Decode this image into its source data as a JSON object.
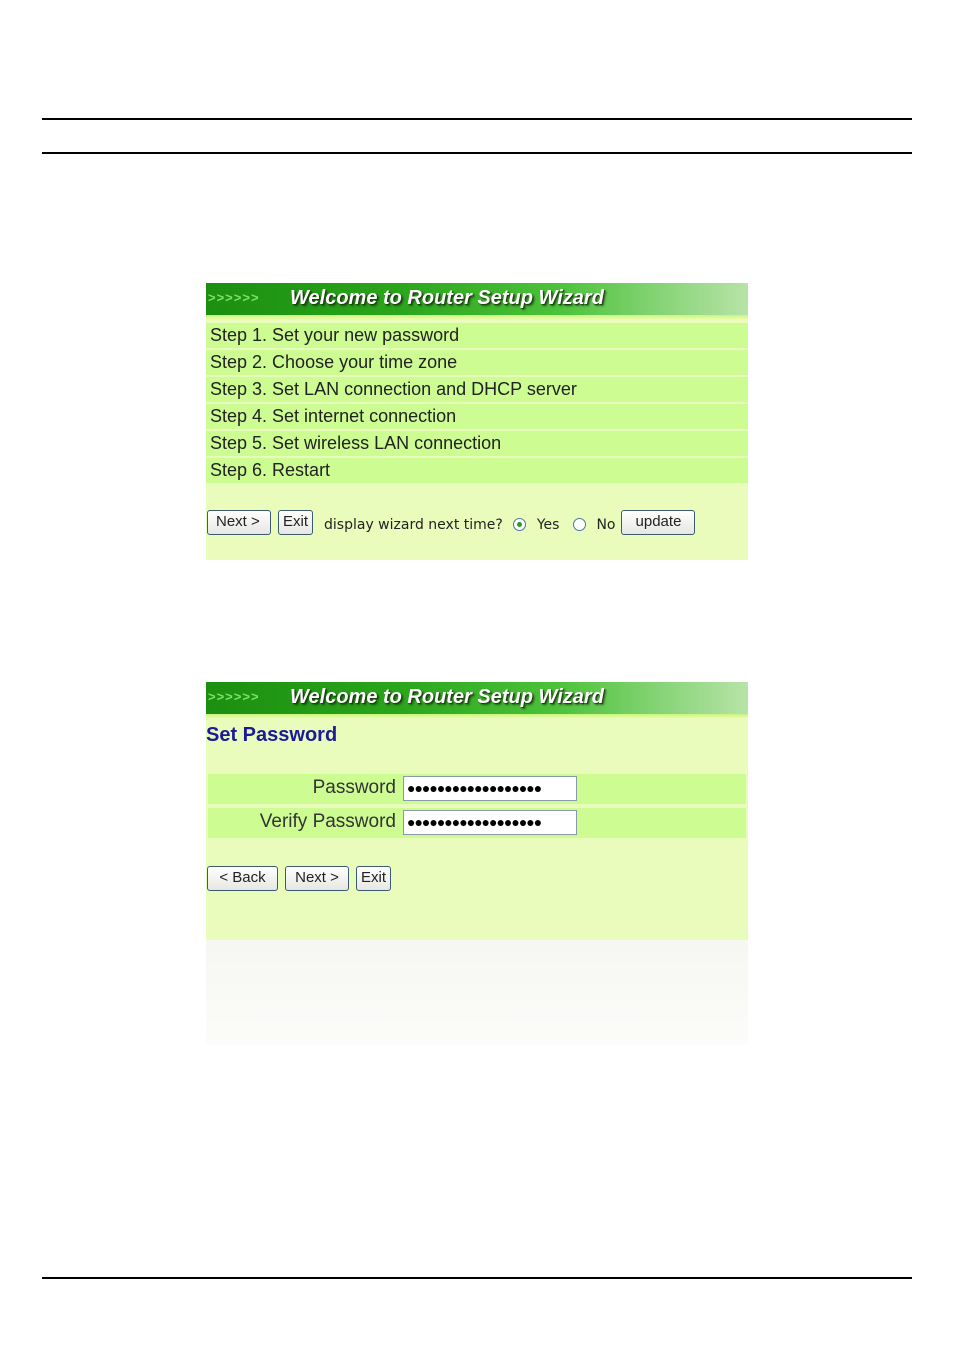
{
  "wizard1": {
    "banner_chevrons": ">>>>>>",
    "banner_title": "Welcome to Router Setup Wizard",
    "steps": [
      "Step 1. Set your new password",
      "Step 2. Choose your time zone",
      "Step 3. Set LAN connection and DHCP server",
      "Step 4. Set internet connection",
      "Step 5. Set wireless LAN connection",
      "Step 6. Restart"
    ],
    "next_label": "Next >",
    "exit_label": "Exit",
    "display_prompt": "display wizard next time?",
    "option_yes": "Yes",
    "option_no": "No",
    "selected_option": "Yes",
    "update_label": "update"
  },
  "wizard2": {
    "banner_chevrons": ">>>>>>",
    "banner_title": "Welcome to Router Setup Wizard",
    "section_title": "Set Password",
    "password_label": "Password",
    "password_value": "●●●●●●●●●●●●●●●●●●",
    "verify_label": "Verify Password",
    "verify_value": "●●●●●●●●●●●●●●●●●●",
    "back_label": "< Back",
    "next_label": "Next >",
    "exit_label": "Exit"
  }
}
